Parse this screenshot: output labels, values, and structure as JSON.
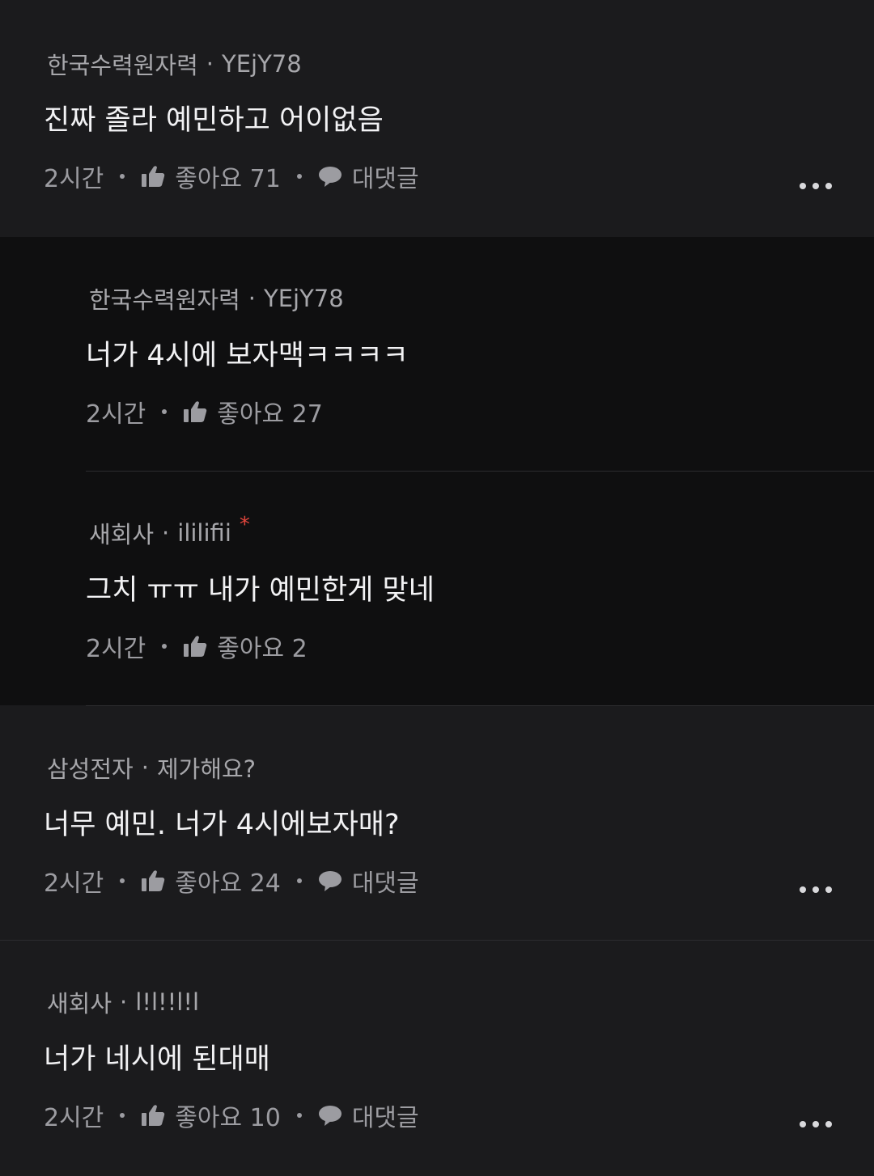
{
  "comments": [
    {
      "company": "한국수력원자력",
      "nickname": "YEjY78",
      "text": "진짜 졸라 예민하고 어이없음",
      "time": "2시간",
      "likes_label": "좋아요 71",
      "reply_label": "대댓글"
    },
    {
      "company": "한국수력원자력",
      "nickname": "YEjY78",
      "text": "너가 4시에 보자맥ㅋㅋㅋㅋ",
      "time": "2시간",
      "likes_label": "좋아요 27"
    },
    {
      "company": "새회사",
      "nickname": "ililifii",
      "author_mark": "*",
      "text": "그치 ㅠㅠ 내가 예민한게 맞네",
      "time": "2시간",
      "likes_label": "좋아요 2"
    },
    {
      "company": "삼성전자",
      "nickname": "제가해요?",
      "text": "너무 예민. 너가 4시에보자매?",
      "time": "2시간",
      "likes_label": "좋아요 24",
      "reply_label": "대댓글"
    },
    {
      "company": "새회사",
      "nickname": "l!l!!l!l",
      "text": "너가 네시에 된대매",
      "time": "2시간",
      "likes_label": "좋아요 10",
      "reply_label": "대댓글"
    }
  ],
  "meta_separator": "·",
  "icons": {
    "like": "thumbs-up-icon",
    "reply": "speech-bubble-icon",
    "more": "more-dots-icon"
  },
  "colors": {
    "background": "#1b1b1d",
    "reply_background": "#0f0f10",
    "author_mark": "#e0453c"
  }
}
